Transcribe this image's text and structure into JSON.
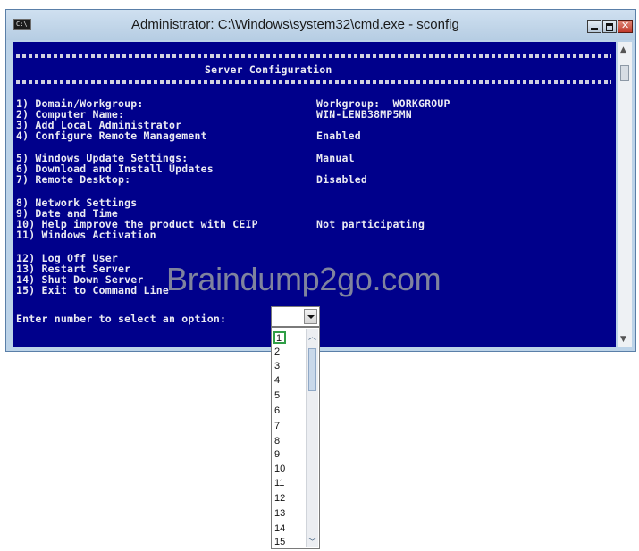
{
  "window": {
    "title": "Administrator: C:\\Windows\\system32\\cmd.exe - sconfig",
    "icon_text": "C:\\"
  },
  "console": {
    "heading": "Server Configuration",
    "menu": [
      {
        "label": "1) Domain/Workgroup:",
        "value": "Workgroup:  WORKGROUP"
      },
      {
        "label": "2) Computer Name:",
        "value": "WIN-LENB38MP5MN"
      },
      {
        "label": "3) Add Local Administrator",
        "value": ""
      },
      {
        "label": "4) Configure Remote Management",
        "value": "Enabled"
      },
      {
        "label": "5) Windows Update Settings:",
        "value": "Manual"
      },
      {
        "label": "6) Download and Install Updates",
        "value": ""
      },
      {
        "label": "7) Remote Desktop:",
        "value": "Disabled"
      },
      {
        "label": "8) Network Settings",
        "value": ""
      },
      {
        "label": "9) Date and Time",
        "value": ""
      },
      {
        "label": "10) Help improve the product with CEIP",
        "value": "Not participating"
      },
      {
        "label": "11) Windows Activation",
        "value": ""
      },
      {
        "label": "12) Log Off User",
        "value": ""
      },
      {
        "label": "13) Restart Server",
        "value": ""
      },
      {
        "label": "14) Shut Down Server",
        "value": ""
      },
      {
        "label": "15) Exit to Command Line",
        "value": ""
      }
    ],
    "prompt": "Enter number to select an option:"
  },
  "dropdown": {
    "selected": "1",
    "options": [
      "1",
      "2",
      "3",
      "4",
      "5",
      "6",
      "7",
      "8",
      "9",
      "10",
      "11",
      "12",
      "13",
      "14",
      "15"
    ]
  },
  "watermark": "Braindump2go.com",
  "colors": {
    "console_bg": "#00008b",
    "console_text": "#eaeaf2",
    "selection_border": "#2f9e46"
  }
}
